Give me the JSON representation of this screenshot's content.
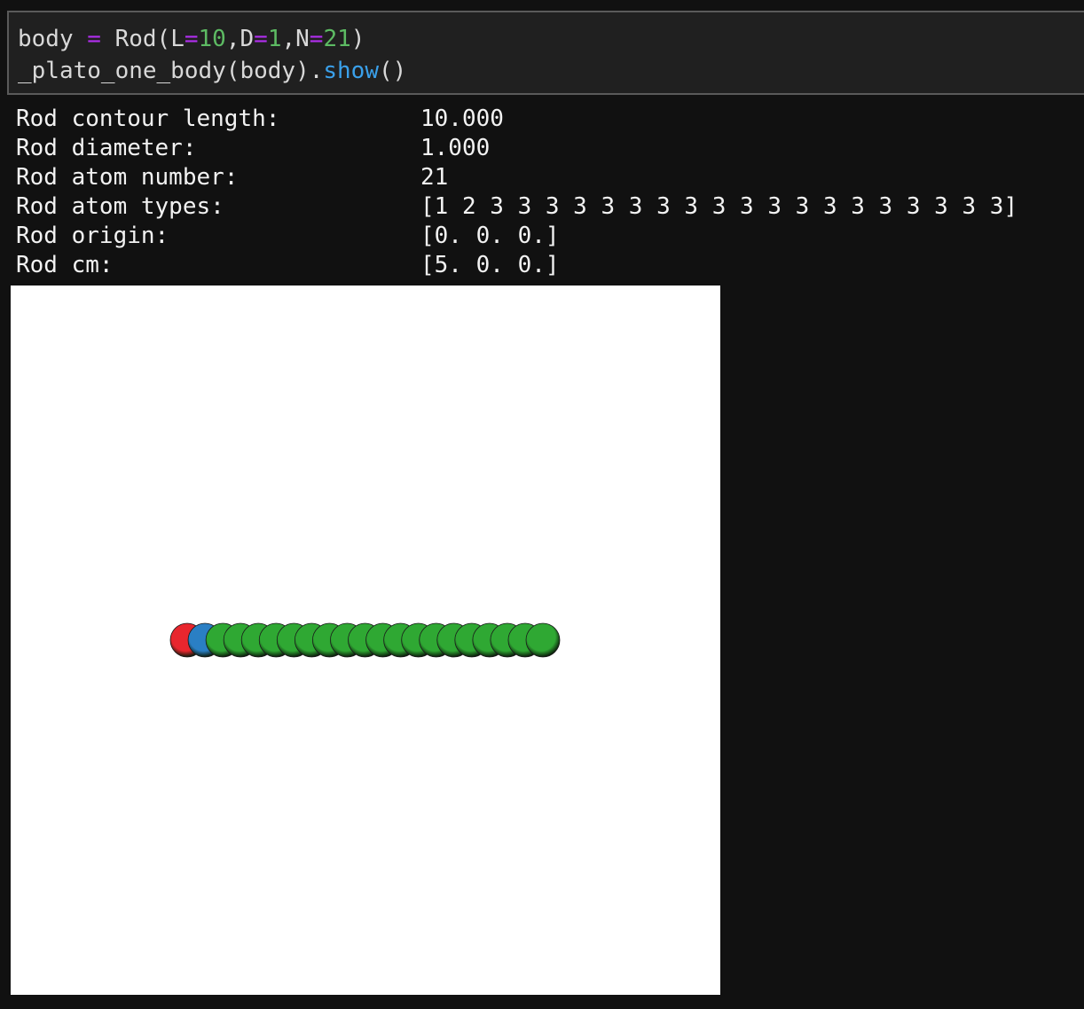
{
  "code": {
    "line1": {
      "var": "body",
      "op": "=",
      "call": "Rod(",
      "k1": "L",
      "v1": "10",
      "k2": "D",
      "v2": "1",
      "k3": "N",
      "v3": "21",
      "close": ")",
      "sep": ","
    },
    "line2": {
      "prefix": "_plato_one_body(body).",
      "method": "show",
      "suffix": "()"
    }
  },
  "output": [
    {
      "label": "Rod contour length:",
      "value": "10.000"
    },
    {
      "label": "Rod diameter:",
      "value": "1.000"
    },
    {
      "label": "Rod atom number:",
      "value": "21"
    },
    {
      "label": "Rod atom types:",
      "value": "[1 2 3 3 3 3 3 3 3 3 3 3 3 3 3 3 3 3 3 3 3]"
    },
    {
      "label": "Rod origin:",
      "value": "[0. 0. 0.]"
    },
    {
      "label": "Rod cm:",
      "value": "[5. 0. 0.]"
    }
  ],
  "visualization": {
    "atom_types": [
      1,
      2,
      3,
      3,
      3,
      3,
      3,
      3,
      3,
      3,
      3,
      3,
      3,
      3,
      3,
      3,
      3,
      3,
      3,
      3,
      3
    ],
    "type_colors": {
      "1": "#e8262e",
      "2": "#2a7fc4",
      "3": "#2fa833"
    }
  }
}
